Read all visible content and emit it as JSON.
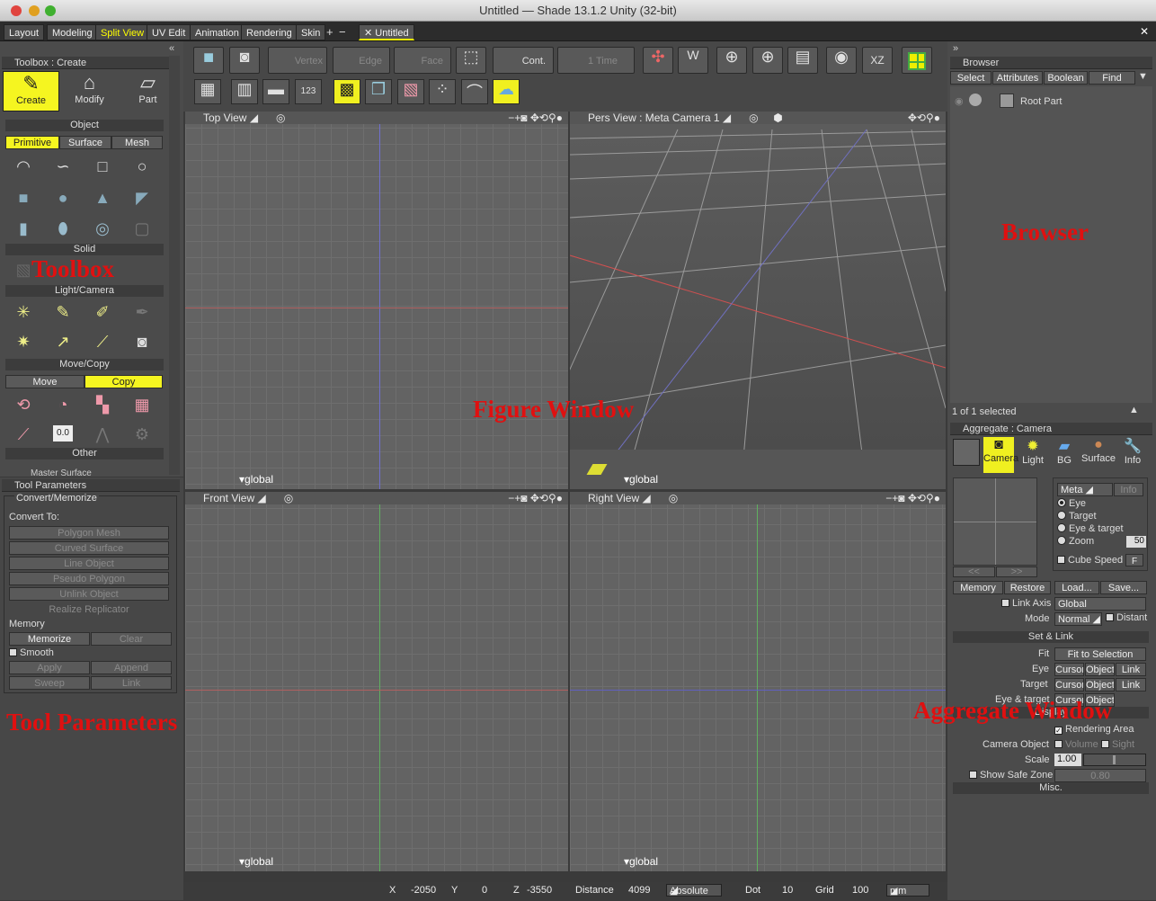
{
  "window": {
    "title": "Untitled — Shade 13.1.2 Unity (32-bit)"
  },
  "tabs": [
    "Layout",
    "Modeling",
    "Split View",
    "UV Edit",
    "Animation",
    "Rendering",
    "Skin"
  ],
  "doc_tab": "✕ Untitled",
  "toolbar": {
    "vertex": "Vertex",
    "edge": "Edge",
    "face": "Face",
    "cont": "Cont.",
    "time": "1 Time"
  },
  "toolbox": {
    "header": "Toolbox : Create",
    "create": "Create",
    "modify": "Modify",
    "part": "Part",
    "object": "Object",
    "primitive": "Primitive",
    "surface": "Surface",
    "mesh": "Mesh",
    "solid": "Solid",
    "light_camera": "Light/Camera",
    "move_copy": "Move/Copy",
    "move": "Move",
    "copy": "Copy",
    "other": "Other",
    "master_surface": "Master Surface"
  },
  "tool_params": {
    "header": "Tool Parameters",
    "convert_memorize": "Convert/Memorize",
    "convert_to": "Convert To:",
    "polygon_mesh": "Polygon Mesh",
    "curved_surface": "Curved Surface",
    "line_object": "Line Object",
    "pseudo_polygon": "Pseudo Polygon",
    "unlink_object": "Unlink Object",
    "realize_replicator": "Realize Replicator",
    "memory": "Memory",
    "memorize": "Memorize",
    "clear": "Clear",
    "smooth": "Smooth",
    "apply": "Apply",
    "append": "Append",
    "sweep": "Sweep",
    "link": "Link"
  },
  "viewports": {
    "top": "Top View",
    "pers": "Pers View : Meta Camera 1",
    "front": "Front View",
    "right": "Right View",
    "global": "global"
  },
  "browser": {
    "header": "Browser",
    "select": "Select",
    "attributes": "Attributes",
    "boolean": "Boolean",
    "find": "Find",
    "root_part": "Root Part",
    "status": "1 of 1 selected"
  },
  "aggregate": {
    "header": "Aggregate : Camera",
    "tabs": [
      "Camera",
      "Light",
      "BG",
      "Surface",
      "Info"
    ],
    "meta": "Meta",
    "info": "Info",
    "eye": "Eye",
    "target": "Target",
    "eye_target": "Eye & target",
    "zoom": "Zoom",
    "zoom_value": "50",
    "cube_speed": "Cube Speed",
    "f": "F",
    "memory": "Memory",
    "restore": "Restore",
    "load": "Load...",
    "save": "Save...",
    "link_axis": "Link Axis",
    "global": "Global",
    "mode": "Mode",
    "normal": "Normal",
    "distant": "Distant",
    "set_link": "Set & Link",
    "fit": "Fit",
    "fit_to_selection": "Fit to Selection",
    "eye_lbl": "Eye",
    "target_lbl": "Target",
    "eye_target_lbl": "Eye & target",
    "cursor": "Cursor",
    "object": "Object",
    "link": "Link",
    "display": "Display",
    "rendering_area": "Rendering Area",
    "camera_object": "Camera Object",
    "volume": "Volume",
    "sight": "Sight",
    "scale": "Scale",
    "scale_value": "1.00",
    "show_safe_zone": "Show Safe Zone",
    "safe_value": "0.80",
    "misc": "Misc."
  },
  "status": {
    "x_label": "X",
    "x": "-2050",
    "y_label": "Y",
    "y": "0",
    "z_label": "Z",
    "z": "-3550",
    "distance_label": "Distance",
    "distance": "4099",
    "absolute": "Absolute",
    "dot_label": "Dot",
    "dot": "10",
    "grid_label": "Grid",
    "grid": "100",
    "unit": "mm"
  },
  "annotations": {
    "toolbox": "Toolbox",
    "tool_parameters": "Tool Parameters",
    "figure_window": "Figure Window",
    "browser": "Browser",
    "aggregate_window": "Aggregate Window"
  }
}
